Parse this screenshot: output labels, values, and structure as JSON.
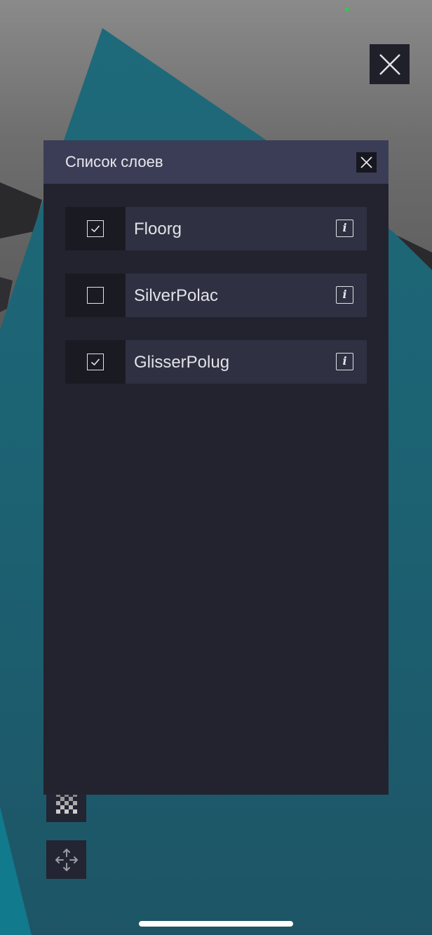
{
  "panel": {
    "title": "Список слоев"
  },
  "layers": [
    {
      "name": "Floorg",
      "checked": true
    },
    {
      "name": "SilverPolac",
      "checked": false
    },
    {
      "name": "GlisserPolug",
      "checked": true
    }
  ],
  "info_glyph": "i",
  "icons": {
    "close": "close-icon",
    "checker": "checkerboard-icon",
    "move": "move-arrows-icon",
    "info": "info-icon",
    "check": "checkmark-icon"
  },
  "colors": {
    "panel_bg": "#23232f",
    "header_bg": "#3b3d56",
    "row_bg": "#2f3041",
    "check_cell_bg": "#1a1a22",
    "teal": "#1f6d7f"
  }
}
